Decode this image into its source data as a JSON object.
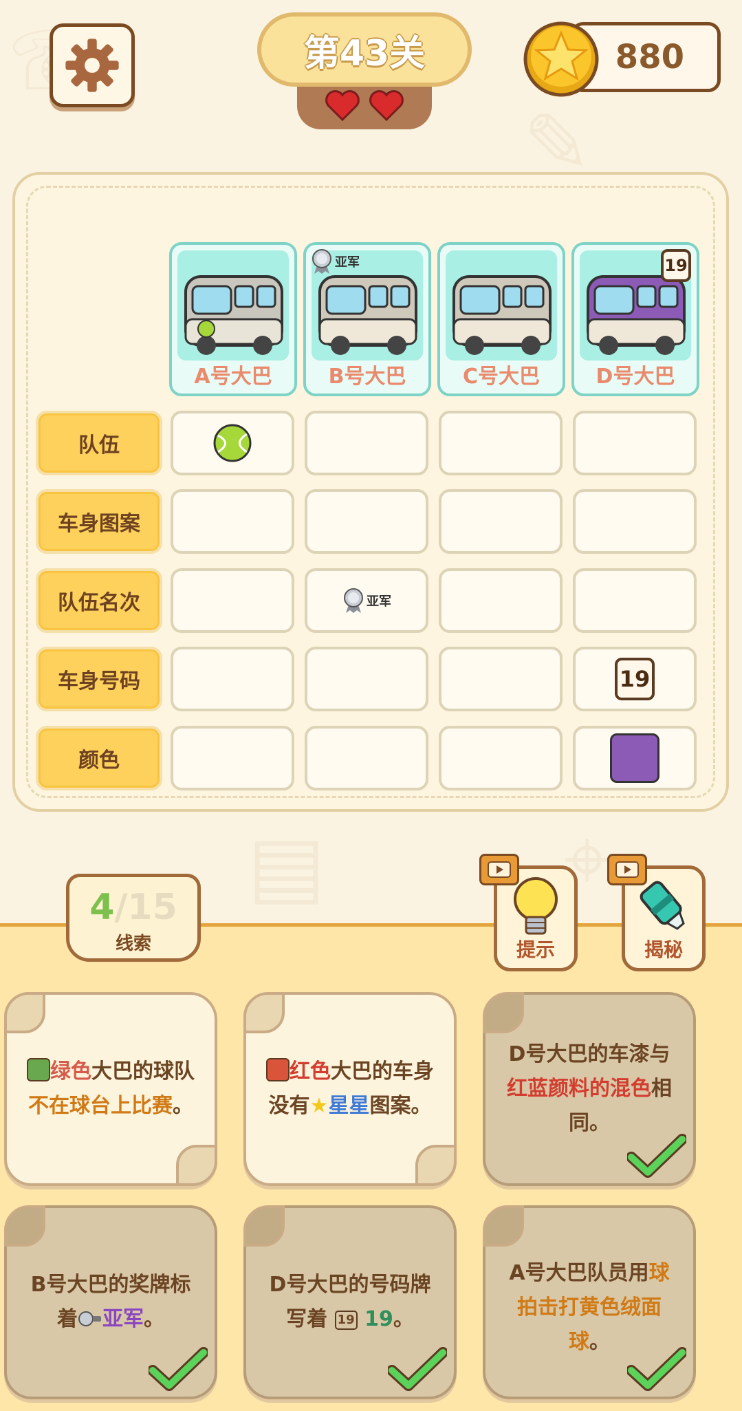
{
  "header": {
    "level_title": "第43关",
    "coins": "880",
    "lives": 2
  },
  "buses": [
    {
      "label": "A号大巴"
    },
    {
      "label": "B号大巴"
    },
    {
      "label": "C号大巴"
    },
    {
      "label": "D号大巴"
    }
  ],
  "bus_card_badges": {
    "b_medal_text": "亚军",
    "d_number": "19"
  },
  "rows": [
    {
      "label": "队伍"
    },
    {
      "label": "车身图案"
    },
    {
      "label": "队伍名次"
    },
    {
      "label": "车身号码"
    },
    {
      "label": "颜色"
    }
  ],
  "grid_values": {
    "team_A": "tennis-ball",
    "rank_B": "亚军",
    "number_D": "19",
    "color_D": "#8b5bb6"
  },
  "clue_counter": {
    "found": "4",
    "separator": "/",
    "total": "15",
    "label": "线索"
  },
  "tools": {
    "hint_label": "提示",
    "reveal_label": "揭秘"
  },
  "clues": [
    {
      "parts": [
        "绿色",
        "大巴的球队",
        "不在球台上比赛",
        "。"
      ],
      "done": false
    },
    {
      "parts": [
        "红色",
        "大巴的车身",
        "没有",
        "星星",
        "图案。"
      ],
      "done": false
    },
    {
      "parts": [
        "D号大巴的车漆与",
        "红蓝颜料的混色",
        "相",
        "同。"
      ],
      "done": true
    },
    {
      "parts": [
        "B号大巴的奖牌标",
        "着",
        "亚军",
        "。"
      ],
      "done": true
    },
    {
      "parts": [
        "D号大巴的号码牌",
        "写着",
        "19",
        "19",
        "。"
      ],
      "done": true
    },
    {
      "parts": [
        "A号大巴队员用",
        "球",
        "拍击打黄色绒面",
        "球",
        "。"
      ],
      "done": true
    }
  ],
  "colors": {
    "green_square": "#6aa84f",
    "red_square": "#d9543b",
    "purple_bus": "#8b5bb6",
    "accent_yellow": "#fdd15c"
  }
}
